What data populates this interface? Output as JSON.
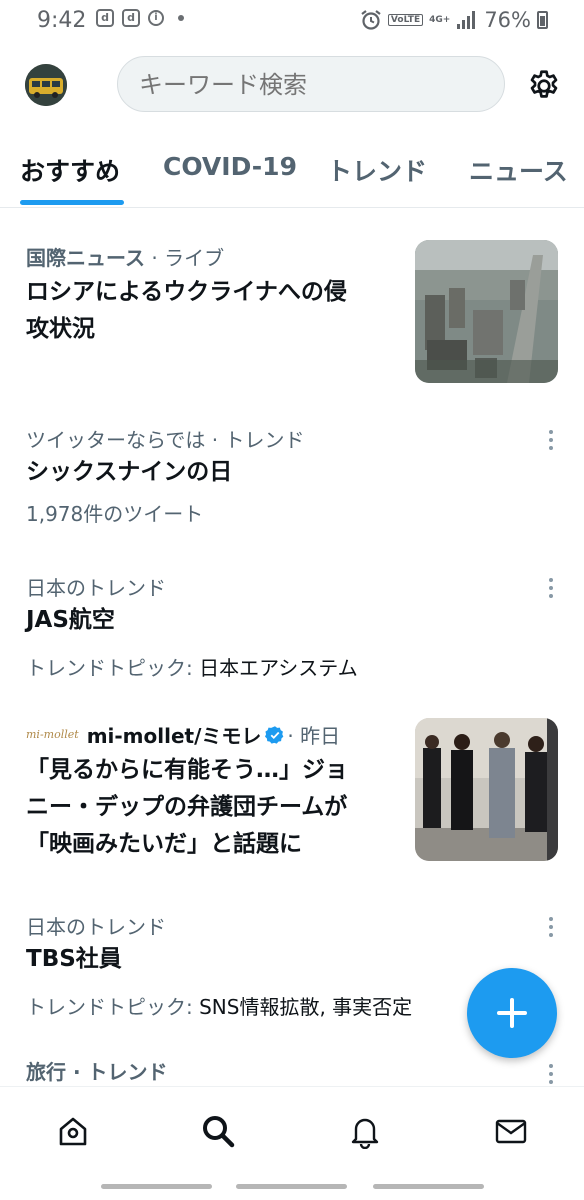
{
  "status_bar": {
    "time": "9:42",
    "notif_icons": [
      "d",
      "d",
      "i"
    ],
    "volte": "VoLTE",
    "network": "4G+",
    "battery": "76%"
  },
  "header": {
    "search_placeholder": "キーワード検索"
  },
  "tabs": [
    {
      "label": "おすすめ",
      "active": true
    },
    {
      "label": "COVID-19"
    },
    {
      "label": "トレンド"
    },
    {
      "label": "ニュース"
    }
  ],
  "feed": [
    {
      "meta": "国際ニュース",
      "meta2": " · ライブ",
      "title_line1": "ロシアによるウクライナへの侵",
      "title_line2": "攻状況"
    },
    {
      "meta": "ツイッターならでは · トレンド",
      "title": "シックスナインの日",
      "sub": "1,978件のツイート"
    },
    {
      "meta": "日本のトレンド",
      "title": "JAS航空",
      "sub_label": "トレンドトピック: ",
      "sub_value": "日本エアシステム"
    },
    {
      "source_logo": "mi-mollet",
      "source": "mi-mollet/ミモレ",
      "time": " · 昨日",
      "title_line1": "「見るからに有能そう…」ジョ",
      "title_line2": "ニー・デップの弁護団チームが",
      "title_line3": "「映画みたいだ」と話題に"
    },
    {
      "meta": "日本のトレンド",
      "title": "TBS社員",
      "sub_label": "トレンドトピック: ",
      "sub_value": "SNS情報拡散, 事実否定"
    },
    {
      "meta": "旅行 · トレンド"
    }
  ],
  "colors": {
    "accent": "#1d9bf0",
    "secondary_text": "#536471",
    "primary_text": "#0f1419"
  }
}
